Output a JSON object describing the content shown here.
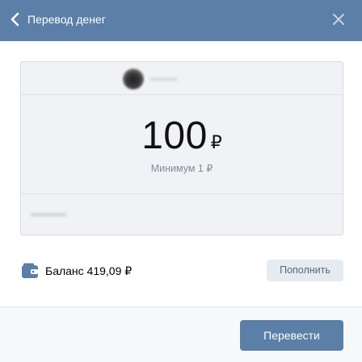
{
  "header": {
    "title": "Перевод денег",
    "back_icon": "chevron-left-icon",
    "close_icon": "close-icon",
    "background_color": "#5b7fa6"
  },
  "transfer": {
    "amount": "100",
    "currency": "₽",
    "minimum_hint": "Минимум 1 ₽"
  },
  "balance": {
    "icon": "wallet-icon",
    "label": "Баланс 419,09 ₽",
    "topup_label": "Пополнить"
  },
  "footer": {
    "submit_label": "Перевести",
    "accent_color": "#5b7fa6"
  }
}
